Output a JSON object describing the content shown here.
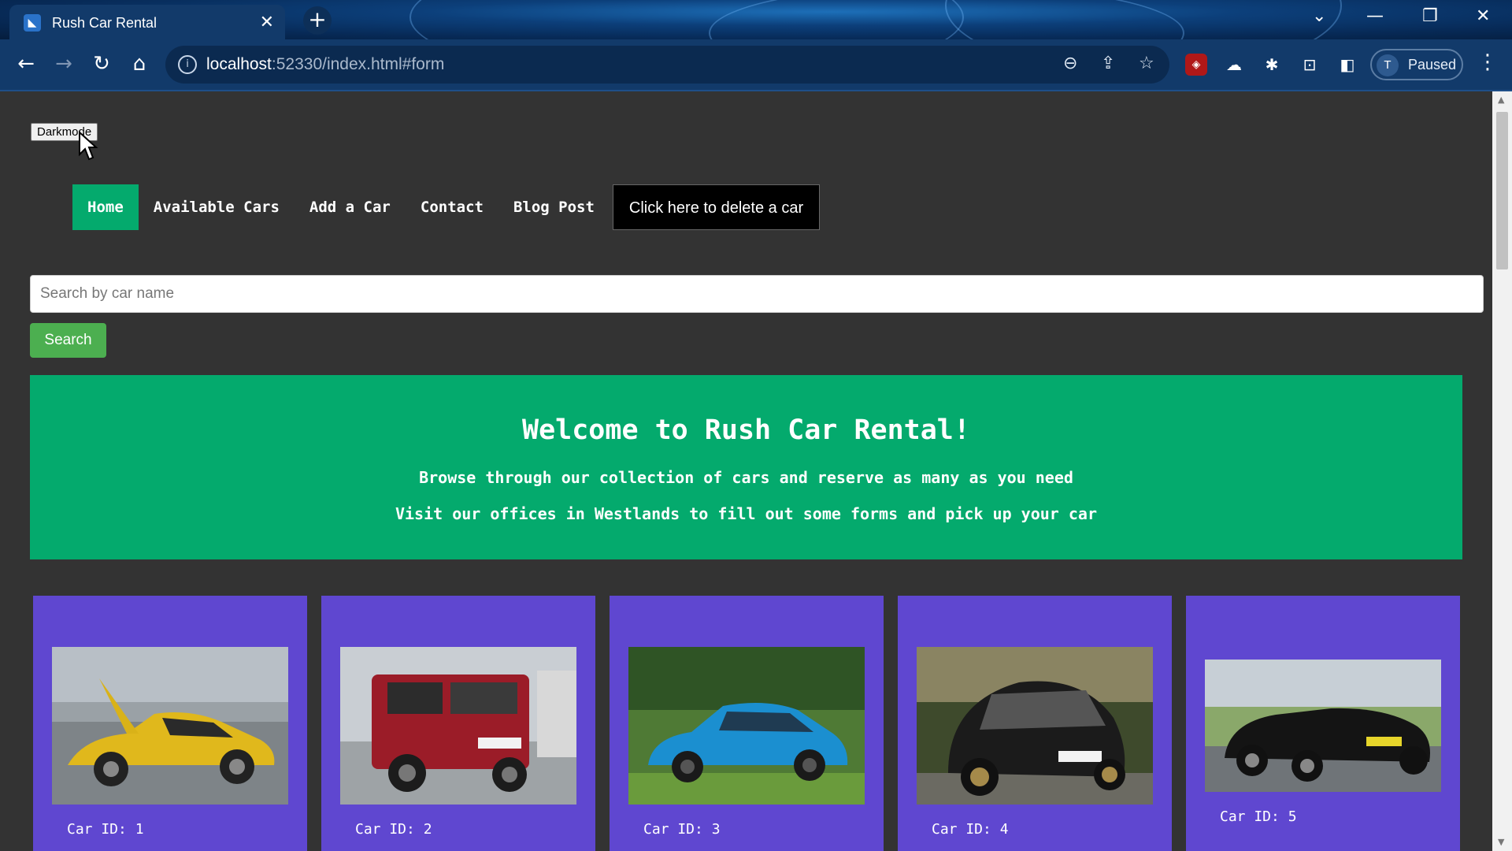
{
  "browser": {
    "tab_title": "Rush Car Rental",
    "url_host": "localhost",
    "url_rest": ":52330/index.html#form",
    "profile_initial": "T",
    "profile_status": "Paused"
  },
  "page": {
    "darkmode_label": "Darkmode",
    "nav": {
      "home": "Home",
      "available_cars": "Available Cars",
      "add_car": "Add a Car",
      "contact": "Contact",
      "blog_post": "Blog Post",
      "delete_car": "Click here to delete a car"
    },
    "search": {
      "placeholder": "Search by car name",
      "button": "Search"
    },
    "hero": {
      "title": "Welcome to Rush Car Rental!",
      "line1": "Browse through our collection of cars and reserve as many as you need",
      "line2": "Visit our offices in Westlands to fill out some forms and pick up your car"
    },
    "cars": [
      {
        "id_label": "Car ID: 1",
        "color": "yellow"
      },
      {
        "id_label": "Car ID: 2",
        "color": "red"
      },
      {
        "id_label": "Car ID: 3",
        "color": "blue"
      },
      {
        "id_label": "Car ID: 4",
        "color": "black"
      },
      {
        "id_label": "Car ID: 5",
        "color": "black"
      }
    ]
  },
  "colors": {
    "page_bg": "#333333",
    "accent_green": "#04aa6d",
    "search_green": "#4caf50",
    "card_purple": "#5f47d0"
  }
}
